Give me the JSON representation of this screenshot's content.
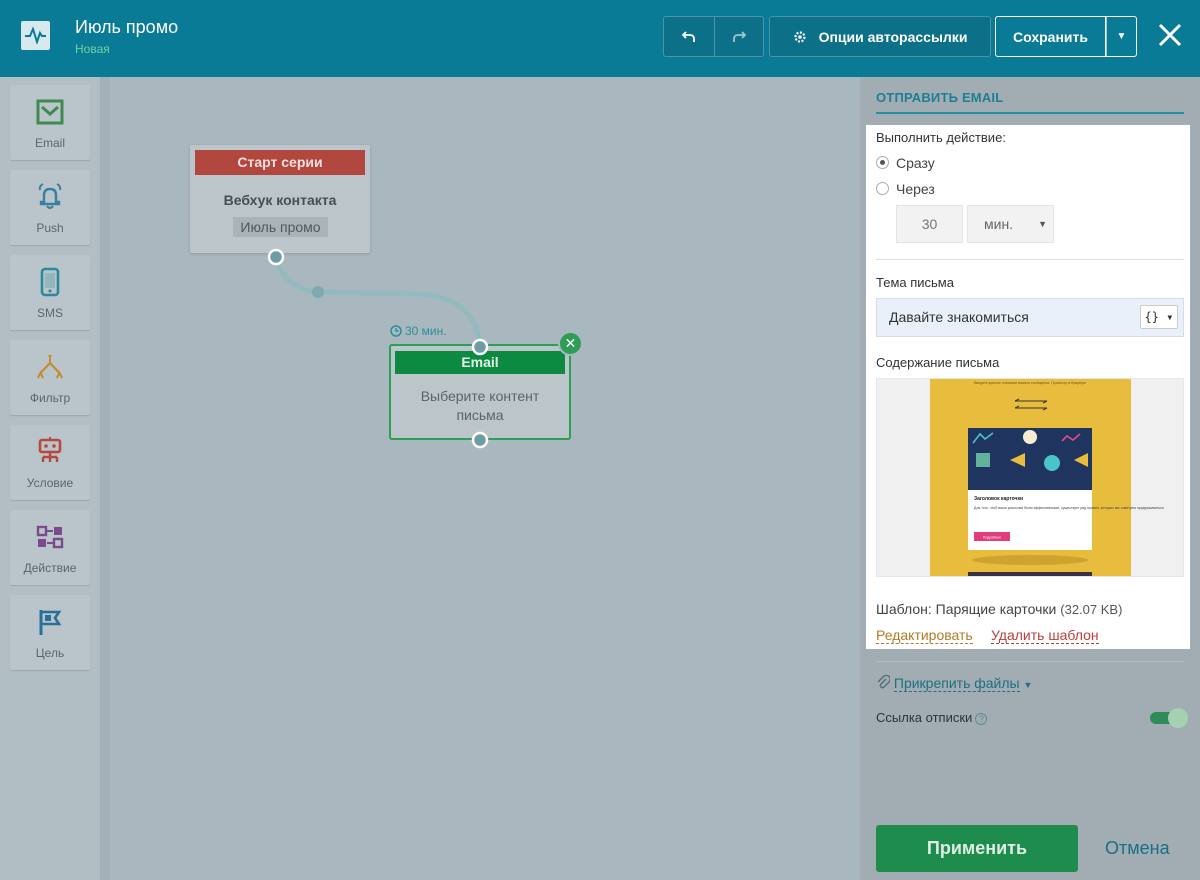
{
  "header": {
    "title": "Июль промо",
    "subtitle": "Новая",
    "options_label": "Опции авторассылки",
    "save_label": "Сохранить"
  },
  "tools": [
    {
      "label": "Email",
      "icon": "email-icon",
      "color": "#3f8a4f"
    },
    {
      "label": "Push",
      "icon": "bell-icon",
      "color": "#3a7fa0"
    },
    {
      "label": "SMS",
      "icon": "phone-icon",
      "color": "#2b8a9a"
    },
    {
      "label": "Фильтр",
      "icon": "filter-icon",
      "color": "#c58a2a"
    },
    {
      "label": "Условие",
      "icon": "condition-icon",
      "color": "#b8473f"
    },
    {
      "label": "Действие",
      "icon": "action-icon",
      "color": "#7a4a8a"
    },
    {
      "label": "Цель",
      "icon": "flag-icon",
      "color": "#2a6f9a"
    }
  ],
  "canvas": {
    "start_node": {
      "header": "Старт серии",
      "name": "Вебхук контакта",
      "badge": "Июль промо"
    },
    "delay_label": "30 мин.",
    "email_node": {
      "header": "Email",
      "text_line1": "Выберите контент",
      "text_line2": "письма"
    }
  },
  "panel": {
    "tab": "ОТПРАВИТЬ EMAIL",
    "action_label": "Выполнить действие:",
    "radio_now": "Сразу",
    "radio_after": "Через",
    "delay_value": "30",
    "delay_unit": "мин.",
    "subject_label": "Тема письма",
    "subject_value": "Давайте знакомиться",
    "var_button": "{}",
    "content_label": "Содержание письма",
    "template_prefix": "Шаблон: Парящие карточки",
    "template_size": "(32.07 KB)",
    "edit_link": "Редактировать",
    "delete_link": "Удалить шаблон",
    "attach_link": "Прикрепить файлы",
    "unsubscribe_label": "Ссылка отписки",
    "help_mark": "?",
    "apply_label": "Применить",
    "cancel_label": "Отмена"
  },
  "preview": {
    "top_text": "Введите краткое описание вашего сообщения. Просмотр в браузере",
    "card_title": "Заголовок карточки",
    "card_body": "Для того, чтоб ваши рассылки были эффективными, существует ряд правил, которых мы советуем придерживаться",
    "card_button": "Подробнее"
  }
}
